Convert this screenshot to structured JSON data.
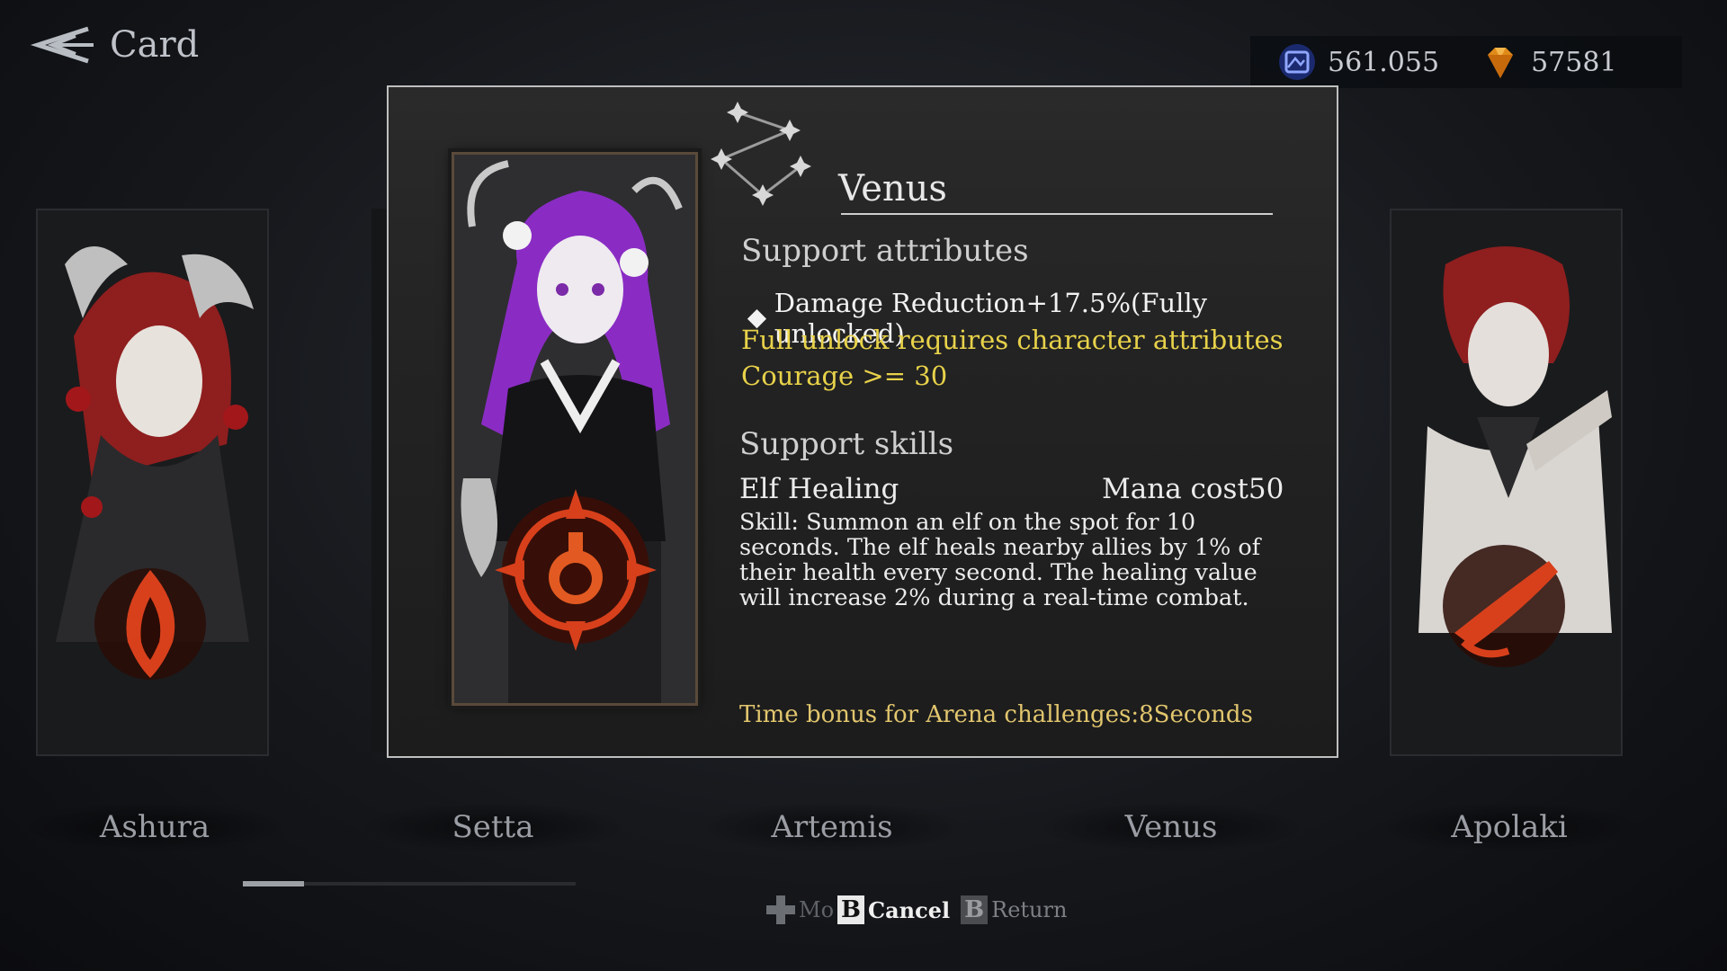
{
  "header": {
    "back_label": "Card"
  },
  "currency": [
    {
      "icon": "crystal-icon",
      "value": "561.055"
    },
    {
      "icon": "gem-icon",
      "value": "57581"
    }
  ],
  "card": {
    "name": "Venus",
    "support_attributes_heading": "Support attributes",
    "attribute": "Damage Reduction+17.5%(Fully unlocked)",
    "requirement_line1": "Full unlock requires character attributes",
    "requirement_line2": "Courage >= 30",
    "support_skills_heading": "Support skills",
    "skill_name": "Elf Healing",
    "mana_cost": "Mana cost50",
    "skill_description": "Skill:  Summon an elf on the spot for 10 seconds. The elf heals nearby allies by 1% of their health every second. The healing value will increase 2% during a real-time combat.",
    "arena_bonus": "Time bonus for Arena challenges:8Seconds"
  },
  "characters": [
    "Ashura",
    "Setta",
    "Artemis",
    "Venus",
    "Apolaki"
  ],
  "footer": {
    "move_label": "Mo",
    "cancel_key": "B",
    "cancel_label": "Cancel",
    "return_key": "B",
    "return_label": "Return"
  },
  "colors": {
    "requirement": "#e8d24a",
    "bonus": "#e2c66e",
    "emblem": "#d8401c"
  }
}
